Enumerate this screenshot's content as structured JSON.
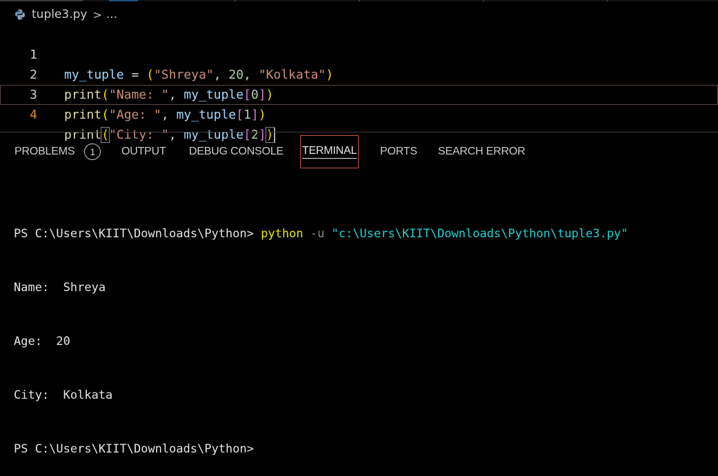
{
  "breadcrumb": {
    "file_name": "tuple3.py",
    "separator": ">",
    "ellipsis": "..."
  },
  "editor": {
    "lines": [
      {
        "number": "1",
        "text": "my_tuple = (\"Shreya\", 20, \"Kolkata\")"
      },
      {
        "number": "2",
        "text": "print(\"Name: \", my_tuple[0])"
      },
      {
        "number": "3",
        "text": "print(\"Age: \", my_tuple[1])"
      },
      {
        "number": "4",
        "text": "print(\"City: \", my_tuple[2])"
      }
    ],
    "tokens": {
      "l1": {
        "var": "my_tuple",
        "eq": " = ",
        "open": "(",
        "s1": "\"Shreya\"",
        "c1": ", ",
        "n1": "20",
        "c2": ", ",
        "s2": "\"Kolkata\"",
        "close": ")"
      },
      "l2": {
        "fn": "print",
        "open": "(",
        "str": "\"Name: \"",
        "comma": ", ",
        "var": "my_tuple",
        "bopen": "[",
        "idx": "0",
        "bclose": "]",
        "close": ")"
      },
      "l3": {
        "fn": "print",
        "open": "(",
        "str": "\"Age: \"",
        "comma": ", ",
        "var": "my_tuple",
        "bopen": "[",
        "idx": "1",
        "bclose": "]",
        "close": ")"
      },
      "l4": {
        "fn": "print",
        "open": "(",
        "str": "\"City: \"",
        "comma": ", ",
        "var": "my_tuple",
        "bopen": "[",
        "idx": "2",
        "bclose": "]",
        "close": ")"
      }
    },
    "active_line": "4"
  },
  "panel": {
    "tabs": [
      {
        "label": "PROBLEMS",
        "badge": "1"
      },
      {
        "label": "OUTPUT"
      },
      {
        "label": "DEBUG CONSOLE"
      },
      {
        "label": "TERMINAL"
      },
      {
        "label": "PORTS"
      },
      {
        "label": "SEARCH ERROR"
      }
    ],
    "active_tab": "TERMINAL"
  },
  "terminal": {
    "prompt": "PS C:\\Users\\KIIT\\Downloads\\Python> ",
    "command": "python",
    "flag": " -u ",
    "argument": "\"c:\\Users\\KIIT\\Downloads\\Python\\tuple3.py\"",
    "output": [
      "Name:  Shreya",
      "Age:  20",
      "City:  Kolkata"
    ],
    "final_prompt": "PS C:\\Users\\KIIT\\Downloads\\Python>"
  },
  "colors": {
    "background": "#000000",
    "active_tab_border": "#c3563a",
    "current_line_number": "#e08a3c",
    "terminal_command": "#e5e510",
    "terminal_argument": "#23d1d1"
  }
}
